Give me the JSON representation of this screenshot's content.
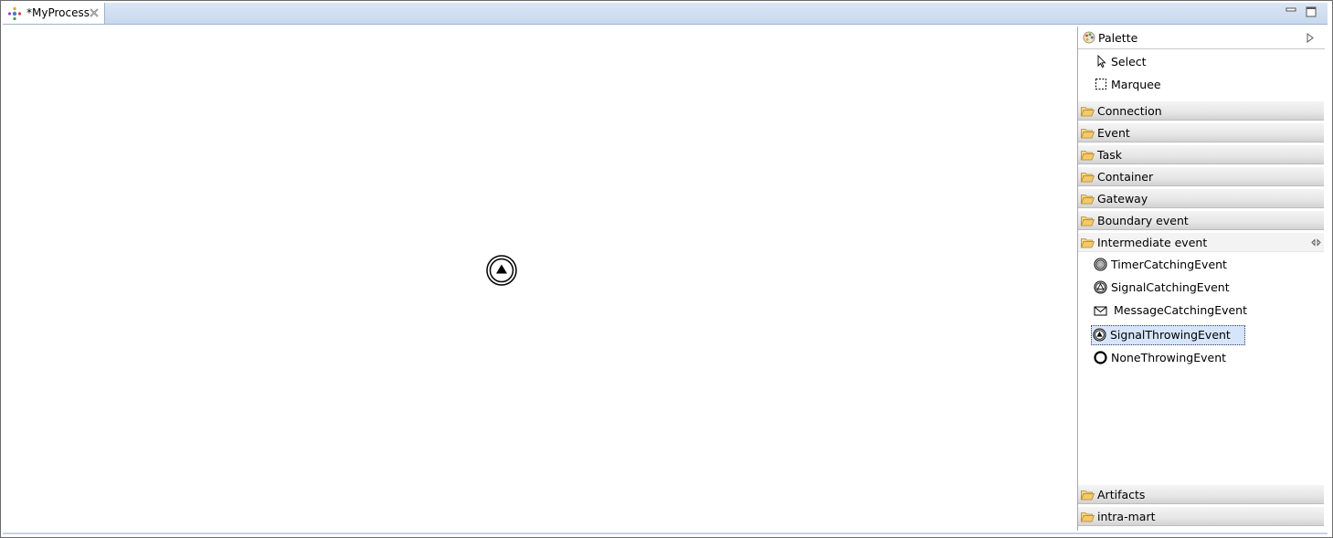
{
  "editor": {
    "tab_title": "*MyProcess",
    "tab_icon": "process-icon",
    "close_icon": "close-icon"
  },
  "window_controls": {
    "minimize_icon": "minimize-icon",
    "maximize_icon": "maximize-icon"
  },
  "canvas": {
    "nodes": [
      {
        "type": "SignalThrowingEvent",
        "icon": "signal-throwing-event-icon"
      }
    ]
  },
  "palette": {
    "title": "Palette",
    "tools": [
      {
        "label": "Select",
        "icon": "cursor-arrow-icon"
      },
      {
        "label": "Marquee",
        "icon": "marquee-icon"
      }
    ],
    "drawers": [
      {
        "label": "Connection",
        "icon": "folder-icon"
      },
      {
        "label": "Event",
        "icon": "folder-icon"
      },
      {
        "label": "Task",
        "icon": "folder-icon"
      },
      {
        "label": "Container",
        "icon": "folder-icon"
      },
      {
        "label": "Gateway",
        "icon": "folder-icon"
      },
      {
        "label": "Boundary event",
        "icon": "folder-icon"
      },
      {
        "label": "Intermediate event",
        "icon": "folder-open-icon",
        "expanded": true
      },
      {
        "label": "Artifacts",
        "icon": "folder-icon"
      },
      {
        "label": "intra-mart",
        "icon": "folder-icon"
      }
    ],
    "intermediate_events": [
      {
        "label": "TimerCatchingEvent",
        "icon": "timer-catching-event-icon"
      },
      {
        "label": "SignalCatchingEvent",
        "icon": "signal-catching-event-icon"
      },
      {
        "label": "MessageCatchingEvent",
        "icon": "message-catching-event-icon"
      },
      {
        "label": "SignalThrowingEvent",
        "icon": "signal-throwing-event-icon",
        "selected": true
      },
      {
        "label": "NoneThrowingEvent",
        "icon": "none-throwing-event-icon"
      }
    ]
  },
  "colors": {
    "tab_bar": "#c8d8ee",
    "selection": "#d6e5fa",
    "folder": "#f5c86a"
  }
}
